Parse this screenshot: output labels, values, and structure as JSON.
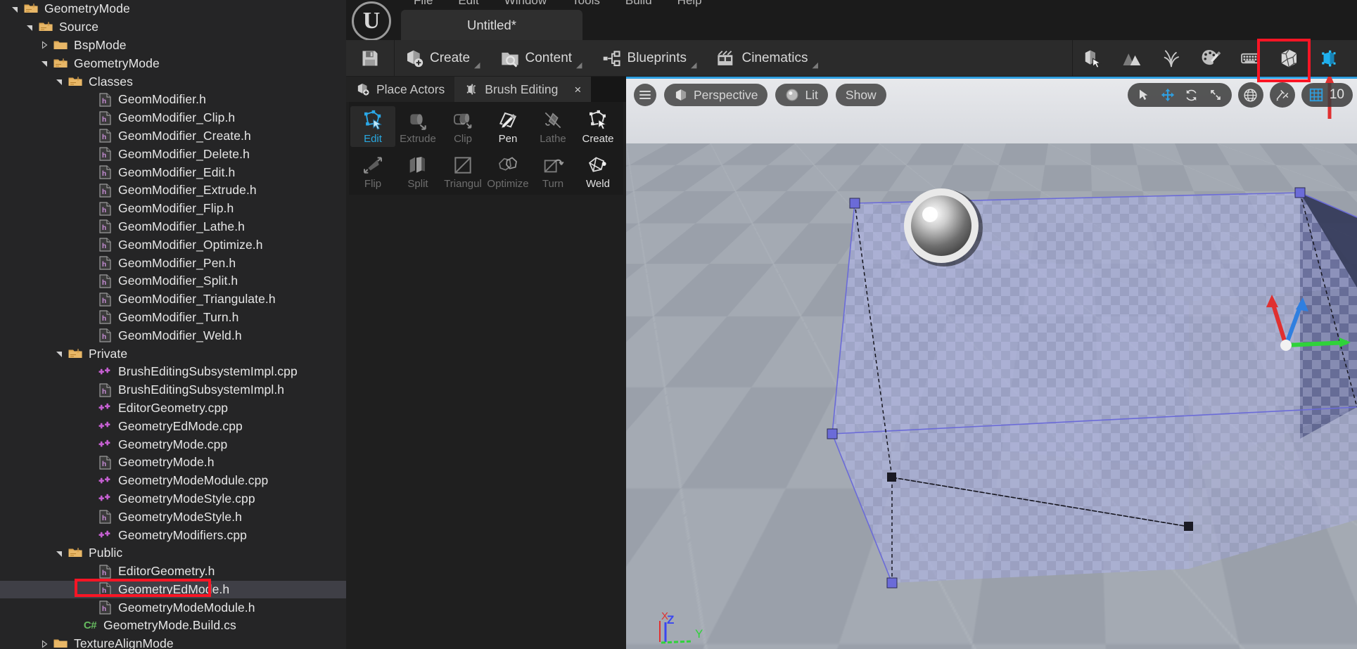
{
  "explorer": {
    "name": "solution-explorer",
    "rows": [
      {
        "depth": 0,
        "twisty": "down",
        "icon": "folder-open",
        "label": "GeometryMode"
      },
      {
        "depth": 1,
        "twisty": "down",
        "icon": "folder-open",
        "label": "Source"
      },
      {
        "depth": 2,
        "twisty": "right",
        "icon": "folder",
        "label": "BspMode"
      },
      {
        "depth": 2,
        "twisty": "down",
        "icon": "folder-open",
        "label": "GeometryMode"
      },
      {
        "depth": 3,
        "twisty": "down",
        "icon": "folder-open",
        "label": "Classes"
      },
      {
        "depth": 5,
        "twisty": "none",
        "icon": "header-file",
        "label": "GeomModifier.h"
      },
      {
        "depth": 5,
        "twisty": "none",
        "icon": "header-file",
        "label": "GeomModifier_Clip.h"
      },
      {
        "depth": 5,
        "twisty": "none",
        "icon": "header-file",
        "label": "GeomModifier_Create.h"
      },
      {
        "depth": 5,
        "twisty": "none",
        "icon": "header-file",
        "label": "GeomModifier_Delete.h"
      },
      {
        "depth": 5,
        "twisty": "none",
        "icon": "header-file",
        "label": "GeomModifier_Edit.h"
      },
      {
        "depth": 5,
        "twisty": "none",
        "icon": "header-file",
        "label": "GeomModifier_Extrude.h"
      },
      {
        "depth": 5,
        "twisty": "none",
        "icon": "header-file",
        "label": "GeomModifier_Flip.h"
      },
      {
        "depth": 5,
        "twisty": "none",
        "icon": "header-file",
        "label": "GeomModifier_Lathe.h"
      },
      {
        "depth": 5,
        "twisty": "none",
        "icon": "header-file",
        "label": "GeomModifier_Optimize.h"
      },
      {
        "depth": 5,
        "twisty": "none",
        "icon": "header-file",
        "label": "GeomModifier_Pen.h"
      },
      {
        "depth": 5,
        "twisty": "none",
        "icon": "header-file",
        "label": "GeomModifier_Split.h"
      },
      {
        "depth": 5,
        "twisty": "none",
        "icon": "header-file",
        "label": "GeomModifier_Triangulate.h"
      },
      {
        "depth": 5,
        "twisty": "none",
        "icon": "header-file",
        "label": "GeomModifier_Turn.h"
      },
      {
        "depth": 5,
        "twisty": "none",
        "icon": "header-file",
        "label": "GeomModifier_Weld.h"
      },
      {
        "depth": 3,
        "twisty": "down",
        "icon": "folder-open",
        "label": "Private"
      },
      {
        "depth": 5,
        "twisty": "none",
        "icon": "cpp-file",
        "label": "BrushEditingSubsystemImpl.cpp"
      },
      {
        "depth": 5,
        "twisty": "none",
        "icon": "header-file",
        "label": "BrushEditingSubsystemImpl.h"
      },
      {
        "depth": 5,
        "twisty": "none",
        "icon": "cpp-file",
        "label": "EditorGeometry.cpp"
      },
      {
        "depth": 5,
        "twisty": "none",
        "icon": "cpp-file",
        "label": "GeometryEdMode.cpp"
      },
      {
        "depth": 5,
        "twisty": "none",
        "icon": "cpp-file",
        "label": "GeometryMode.cpp"
      },
      {
        "depth": 5,
        "twisty": "none",
        "icon": "header-file",
        "label": "GeometryMode.h"
      },
      {
        "depth": 5,
        "twisty": "none",
        "icon": "cpp-file",
        "label": "GeometryModeModule.cpp"
      },
      {
        "depth": 5,
        "twisty": "none",
        "icon": "cpp-file",
        "label": "GeometryModeStyle.cpp"
      },
      {
        "depth": 5,
        "twisty": "none",
        "icon": "header-file",
        "label": "GeometryModeStyle.h"
      },
      {
        "depth": 5,
        "twisty": "none",
        "icon": "cpp-file",
        "label": "GeometryModifiers.cpp"
      },
      {
        "depth": 3,
        "twisty": "down",
        "icon": "folder-open",
        "label": "Public"
      },
      {
        "depth": 5,
        "twisty": "none",
        "icon": "header-file",
        "label": "EditorGeometry.h"
      },
      {
        "depth": 5,
        "twisty": "none",
        "icon": "header-file",
        "label": "GeometryEdMode.h",
        "selected": true
      },
      {
        "depth": 5,
        "twisty": "none",
        "icon": "header-file",
        "label": "GeometryModeModule.h"
      },
      {
        "depth": 4,
        "twisty": "none",
        "icon": "csharp-file",
        "label": "GeometryMode.Build.cs"
      },
      {
        "depth": 2,
        "twisty": "right",
        "icon": "folder",
        "label": "TextureAlignMode"
      }
    ]
  },
  "annotations": {
    "file_highlight_name": "annotation-box-geometryedmode-h",
    "mode_highlight_name": "annotation-box-brush-editing-mode",
    "color": "#fb1525"
  },
  "unreal": {
    "logo_glyph": "U",
    "menu": [
      "File",
      "Edit",
      "Window",
      "Tools",
      "Build",
      "Help"
    ],
    "level_tab": "Untitled*",
    "toolbar": {
      "save_label": "",
      "buttons": [
        {
          "label": "Create",
          "icon": "create-icon",
          "caret": true
        },
        {
          "label": "Content",
          "icon": "content-icon",
          "caret": true
        },
        {
          "label": "Blueprints",
          "icon": "blueprints-icon",
          "caret": true
        },
        {
          "label": "Cinematics",
          "icon": "cinematics-icon",
          "caret": true
        }
      ],
      "modes": [
        {
          "name": "select-mode-icon",
          "active": false
        },
        {
          "name": "landscape-mode-icon",
          "active": false
        },
        {
          "name": "foliage-mode-icon",
          "active": false
        },
        {
          "name": "mesh-paint-mode-icon",
          "active": false
        },
        {
          "name": "modeling-mode-icon",
          "active": false
        },
        {
          "name": "fracture-mode-icon",
          "active": false
        },
        {
          "name": "brush-editing-mode-icon",
          "active": true
        }
      ]
    },
    "panel": {
      "tabs": [
        {
          "label": "Place Actors",
          "icon": "place-actors-icon",
          "active": false,
          "closable": false
        },
        {
          "label": "Brush Editing",
          "icon": "brush-editing-icon",
          "active": true,
          "closable": true,
          "close_glyph": "×"
        }
      ],
      "tools_row1": [
        {
          "label": "Edit",
          "icon": "edit-tool-icon",
          "state": "active"
        },
        {
          "label": "Extrude",
          "icon": "extrude-tool-icon",
          "state": "dim"
        },
        {
          "label": "Clip",
          "icon": "clip-tool-icon",
          "state": "dim"
        },
        {
          "label": "Pen",
          "icon": "pen-tool-icon",
          "state": "bright"
        },
        {
          "label": "Lathe",
          "icon": "lathe-tool-icon",
          "state": "dim"
        },
        {
          "label": "Create",
          "icon": "create-tool-icon",
          "state": "bright"
        }
      ],
      "tools_row2": [
        {
          "label": "Flip",
          "icon": "flip-tool-icon",
          "state": "dim"
        },
        {
          "label": "Split",
          "icon": "split-tool-icon",
          "state": "dim"
        },
        {
          "label": "Triangul",
          "icon": "triangulate-tool-icon",
          "state": "dim"
        },
        {
          "label": "Optimize",
          "icon": "optimize-tool-icon",
          "state": "dim"
        },
        {
          "label": "Turn",
          "icon": "turn-tool-icon",
          "state": "dim"
        },
        {
          "label": "Weld",
          "icon": "weld-tool-icon",
          "state": "bright"
        }
      ]
    },
    "viewport": {
      "menu_icon": "viewport-menu-icon",
      "camera_mode": "Perspective",
      "view_mode": "Lit",
      "show_label": "Show",
      "transform_tools": [
        {
          "name": "select-tool-icon",
          "active": false
        },
        {
          "name": "move-tool-icon",
          "active": true
        },
        {
          "name": "rotate-tool-icon",
          "active": false
        },
        {
          "name": "scale-tool-icon",
          "active": false
        }
      ],
      "coord_space_icon": "world-coordinates-icon",
      "surface_snap_icon": "surface-snapping-icon",
      "grid_snap_icon": "grid-snap-icon",
      "grid_snap_value": "10",
      "axis_labels": {
        "x": "X",
        "y": "Y",
        "z": "Z"
      },
      "axis_colors": {
        "x": "#e03030",
        "y": "#2fd23a",
        "z": "#3a46f0"
      },
      "accent_color": "#2f9fe0"
    }
  }
}
